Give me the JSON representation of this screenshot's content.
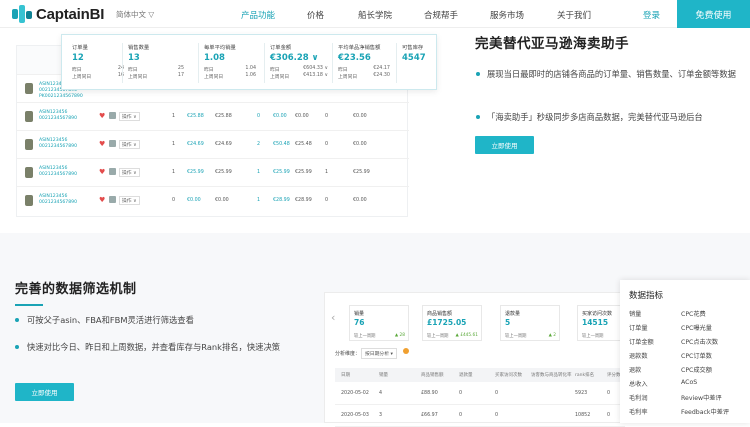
{
  "nav": {
    "logo": "CaptainBI",
    "lang": "简体中文 ▽",
    "menu": [
      "产品功能",
      "价格",
      "船长学院",
      "合规帮手",
      "服务市场",
      "关于我们"
    ],
    "login": "登录",
    "free_btn": "免费使用"
  },
  "popup": [
    {
      "title": "订单量",
      "value": "12",
      "a_label": "昨日",
      "a_val": "24",
      "b_label": "上周同日",
      "b_val": "16"
    },
    {
      "title": "销售数量",
      "value": "13",
      "a_label": "昨日",
      "a_val": "25",
      "b_label": "上周同日",
      "b_val": "17"
    },
    {
      "title": "每单平均销量",
      "value": "1.08",
      "a_label": "昨日",
      "a_val": "1.04",
      "b_label": "上周同日",
      "b_val": "1.06"
    },
    {
      "title": "订单金额",
      "value": "€306.28 ∨",
      "a_label": "昨日",
      "a_val": "€604.33 ∨",
      "b_label": "上周同日",
      "b_val": "€413.18 ∨"
    },
    {
      "title": "平均单品净销售额",
      "value": "€23.56",
      "a_label": "昨日",
      "a_val": "€24.17",
      "b_label": "上周同日",
      "b_val": "€24.30"
    },
    {
      "title": "可售库存",
      "value": "4547",
      "a_label": "",
      "a_val": "",
      "b_label": "",
      "b_val": ""
    }
  ],
  "table_rows": [
    {
      "asin": "ASIN1234567",
      "sub": "0021234567890",
      "sub2": "PK0021234567890",
      "cells": []
    },
    {
      "asin": "ASIN123456",
      "sub": "0021234567890",
      "cells": [
        "1",
        "€25.88",
        "€25.88",
        "0",
        "€0.00",
        "€0.00",
        "0",
        "€0.00"
      ]
    },
    {
      "asin": "ASIN123456",
      "sub": "0021234567890",
      "cells": [
        "1",
        "€24.69",
        "€24.69",
        "2",
        "€50.48",
        "€25.48",
        "0",
        "€0.00"
      ]
    },
    {
      "asin": "ASIN123456",
      "sub": "0021234567890",
      "cells": [
        "1",
        "€25.99",
        "€25.99",
        "1",
        "€25.99",
        "€25.99",
        "1",
        "€25.99"
      ]
    },
    {
      "asin": "ASIN123456",
      "sub": "0021234567890",
      "cells": [
        "0",
        "€0.00",
        "€0.00",
        "1",
        "€28.99",
        "€28.99",
        "0",
        "€0.00"
      ]
    }
  ],
  "op_label": "操作 ∨",
  "right_heading": "完美替代亚马逊海卖助手",
  "right_bullets": [
    "展现当日最即时的店铺各商品的订单量、销售数量、订单金额等数据",
    "「海卖助手」秒级同步多店商品数据，完美替代亚马逊后台"
  ],
  "use_btn": "立即使用",
  "left_heading": "完善的数据筛选机制",
  "left_bullets": [
    "可按父子asin、FBA和FBM灵活进行筛选查看",
    "快速对比今日、昨日和上周数据，并查看库存与Rank排名，快速决策"
  ],
  "kpis": [
    {
      "t": "销量",
      "v": "76",
      "s": "较上一周期",
      "c": "28"
    },
    {
      "t": "商品销售额",
      "v": "£1725.05",
      "s": "较上一周期",
      "c": "£445.61"
    },
    {
      "t": "退款量",
      "v": "5",
      "s": "较上一周期",
      "c": "2"
    },
    {
      "t": "买家访问次数",
      "v": "14515",
      "s": "较上一周期",
      "c": "9"
    }
  ],
  "filter_label": "分析维度：",
  "filter_select": "按日期分析 ▾",
  "dash_headers": [
    "日期",
    "销量",
    "商品销售额",
    "退款量",
    "买家访问次数",
    "访客数与商品转化率",
    "rank排名",
    "评分数"
  ],
  "dash_rows": [
    [
      "2020-05-02",
      "4",
      "£88.90",
      "0",
      "0",
      "",
      "5923",
      "0"
    ],
    [
      "2020-05-03",
      "3",
      "£66.97",
      "0",
      "0",
      "",
      "10852",
      "0"
    ]
  ],
  "metrics": {
    "title": "数据指标",
    "left": [
      "销量",
      "订单量",
      "订单金额",
      "退款数",
      "退款",
      "总收入",
      "毛利润",
      "毛利率"
    ],
    "right": [
      "CPC花费",
      "CPC曝光量",
      "CPC点击次数",
      "CPC订单数",
      "CPC成交额",
      "ACoS",
      "Review中差评",
      "Feedback中差评"
    ]
  }
}
